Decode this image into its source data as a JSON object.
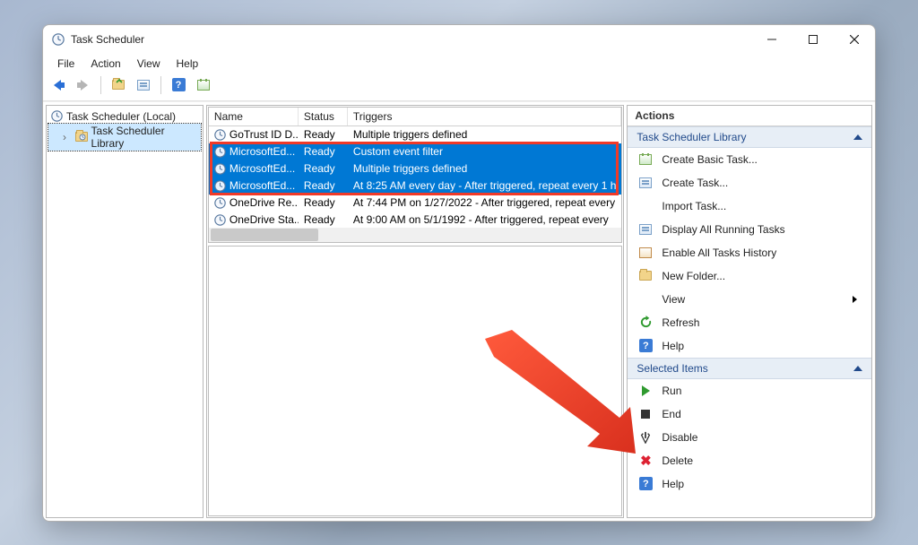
{
  "title": "Task Scheduler",
  "menu": {
    "file": "File",
    "action": "Action",
    "view": "View",
    "help": "Help"
  },
  "tree": {
    "root": "Task Scheduler (Local)",
    "lib": "Task Scheduler Library"
  },
  "columns": {
    "name": "Name",
    "status": "Status",
    "triggers": "Triggers"
  },
  "tasks": [
    {
      "name": "GoTrust ID D...",
      "status": "Ready",
      "trigger": "Multiple triggers defined",
      "selected": false
    },
    {
      "name": "MicrosoftEd...",
      "status": "Ready",
      "trigger": "Custom event filter",
      "selected": true
    },
    {
      "name": "MicrosoftEd...",
      "status": "Ready",
      "trigger": "Multiple triggers defined",
      "selected": true
    },
    {
      "name": "MicrosoftEd...",
      "status": "Ready",
      "trigger": "At 8:25 AM every day - After triggered, repeat every 1 h",
      "selected": true
    },
    {
      "name": "OneDrive Re...",
      "status": "Ready",
      "trigger": "At 7:44 PM on 1/27/2022 - After triggered, repeat every",
      "selected": false
    },
    {
      "name": "OneDrive Sta...",
      "status": "Ready",
      "trigger": "At 9:00 AM on 5/1/1992 - After triggered, repeat every",
      "selected": false
    }
  ],
  "actions_title": "Actions",
  "section1": "Task Scheduler Library",
  "section2": "Selected Items",
  "lib_actions": {
    "create_basic": "Create Basic Task...",
    "create": "Create Task...",
    "import": "Import Task...",
    "display_running": "Display All Running Tasks",
    "enable_hist": "Enable All Tasks History",
    "new_folder": "New Folder...",
    "view": "View",
    "refresh": "Refresh",
    "help": "Help"
  },
  "sel_actions": {
    "run": "Run",
    "end": "End",
    "disable": "Disable",
    "delete": "Delete",
    "help": "Help"
  }
}
